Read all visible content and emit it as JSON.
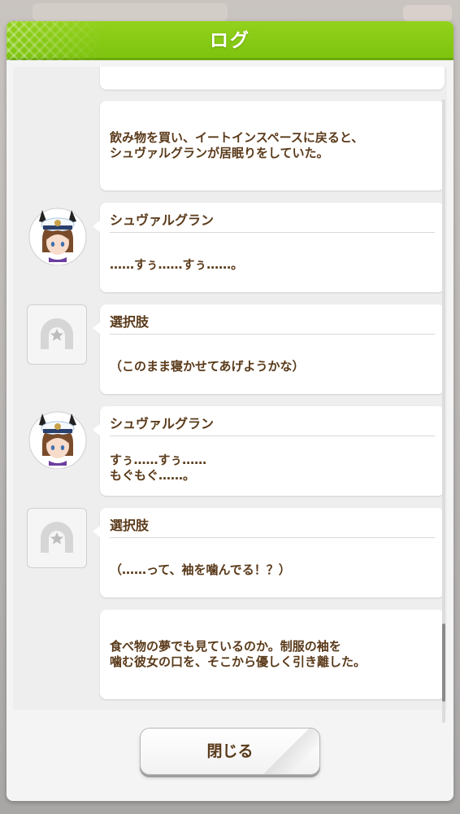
{
  "window": {
    "title": "ログ"
  },
  "log": {
    "entries": [
      {
        "type": "narration",
        "text": ""
      },
      {
        "type": "narration",
        "text": "飲み物を買い、イートインスペースに戻ると、\nシュヴァルグランが居眠りをしていた。"
      },
      {
        "type": "dialogue",
        "speaker": "シュヴァルグラン",
        "avatar": "character-portrait",
        "text": "……すぅ……すぅ……。"
      },
      {
        "type": "choice",
        "speaker": "選択肢",
        "avatar": "horseshoe-star-icon",
        "text": "（このまま寝かせてあげようかな）"
      },
      {
        "type": "dialogue",
        "speaker": "シュヴァルグラン",
        "avatar": "character-portrait",
        "text": "すぅ……すぅ……\nもぐもぐ……。"
      },
      {
        "type": "choice",
        "speaker": "選択肢",
        "avatar": "horseshoe-star-icon",
        "text": "（……って、袖を噛んでる！？）"
      },
      {
        "type": "narration",
        "text": "食べ物の夢でも見ているのか。制服の袖を\n噛む彼女の口を、そこから優しく引き離した。"
      }
    ],
    "scroll_position": 0.95
  },
  "footer": {
    "close_label": "閉じる"
  },
  "colors": {
    "header": "#7ec40f",
    "text": "#5a3a1a",
    "bubble": "#ffffff",
    "panel": "#f4f4f4"
  }
}
